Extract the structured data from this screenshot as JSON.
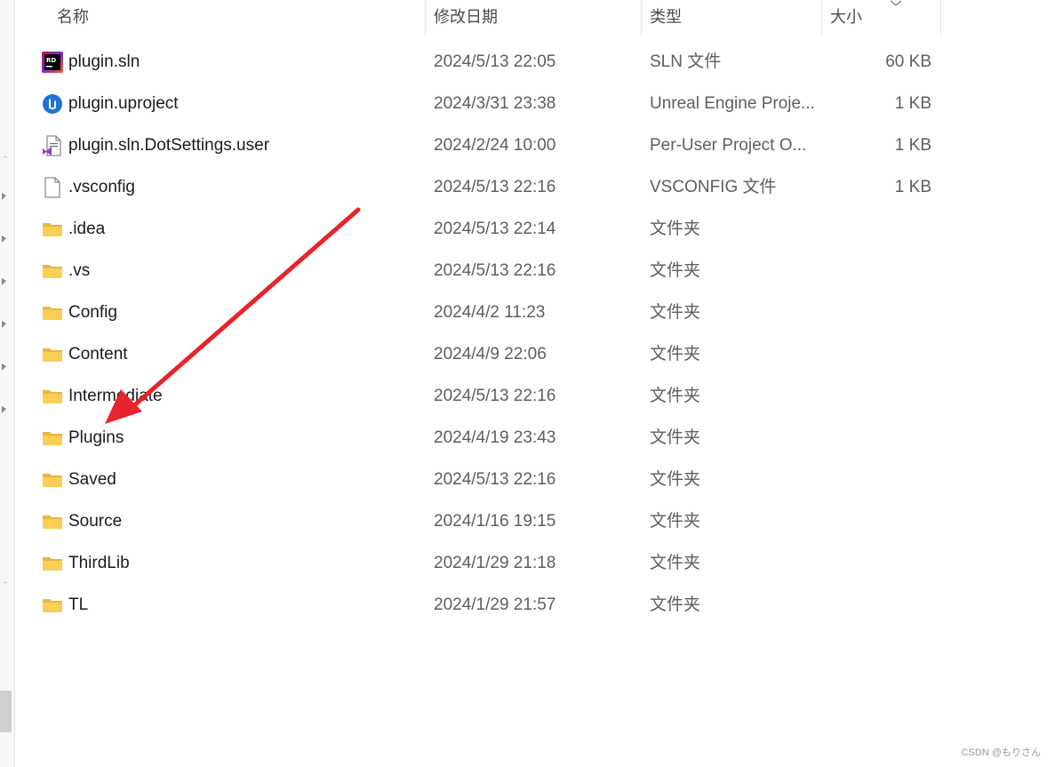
{
  "header": {
    "name": "名称",
    "date": "修改日期",
    "type": "类型",
    "size": "大小"
  },
  "files": [
    {
      "name": "plugin.sln",
      "date": "2024/5/13 22:05",
      "type": "SLN 文件",
      "size": "60 KB",
      "icon": "rider-sln-icon"
    },
    {
      "name": "plugin.uproject",
      "date": "2024/3/31 23:38",
      "type": "Unreal Engine Proje...",
      "size": "1 KB",
      "icon": "unreal-engine-icon"
    },
    {
      "name": "plugin.sln.DotSettings.user",
      "date": "2024/2/24 10:00",
      "type": "Per-User Project O...",
      "size": "1 KB",
      "icon": "visual-studio-file-icon"
    },
    {
      "name": ".vsconfig",
      "date": "2024/5/13 22:16",
      "type": "VSCONFIG 文件",
      "size": "1 KB",
      "icon": "blank-file-icon"
    },
    {
      "name": ".idea",
      "date": "2024/5/13 22:14",
      "type": "文件夹",
      "size": "",
      "icon": "folder-icon"
    },
    {
      "name": ".vs",
      "date": "2024/5/13 22:16",
      "type": "文件夹",
      "size": "",
      "icon": "folder-icon"
    },
    {
      "name": "Config",
      "date": "2024/4/2 11:23",
      "type": "文件夹",
      "size": "",
      "icon": "folder-icon"
    },
    {
      "name": "Content",
      "date": "2024/4/9 22:06",
      "type": "文件夹",
      "size": "",
      "icon": "folder-icon"
    },
    {
      "name": "Intermediate",
      "date": "2024/5/13 22:16",
      "type": "文件夹",
      "size": "",
      "icon": "folder-icon"
    },
    {
      "name": "Plugins",
      "date": "2024/4/19 23:43",
      "type": "文件夹",
      "size": "",
      "icon": "folder-icon"
    },
    {
      "name": "Saved",
      "date": "2024/5/13 22:16",
      "type": "文件夹",
      "size": "",
      "icon": "folder-icon"
    },
    {
      "name": "Source",
      "date": "2024/1/16 19:15",
      "type": "文件夹",
      "size": "",
      "icon": "folder-icon"
    },
    {
      "name": "ThirdLib",
      "date": "2024/1/29 21:18",
      "type": "文件夹",
      "size": "",
      "icon": "folder-icon"
    },
    {
      "name": "TL",
      "date": "2024/1/29 21:57",
      "type": "文件夹",
      "size": "",
      "icon": "folder-icon"
    }
  ],
  "annotation": {
    "color": "#e8232b",
    "icon": "red-arrow-pointer"
  },
  "watermark": "CSDN @もりさん"
}
